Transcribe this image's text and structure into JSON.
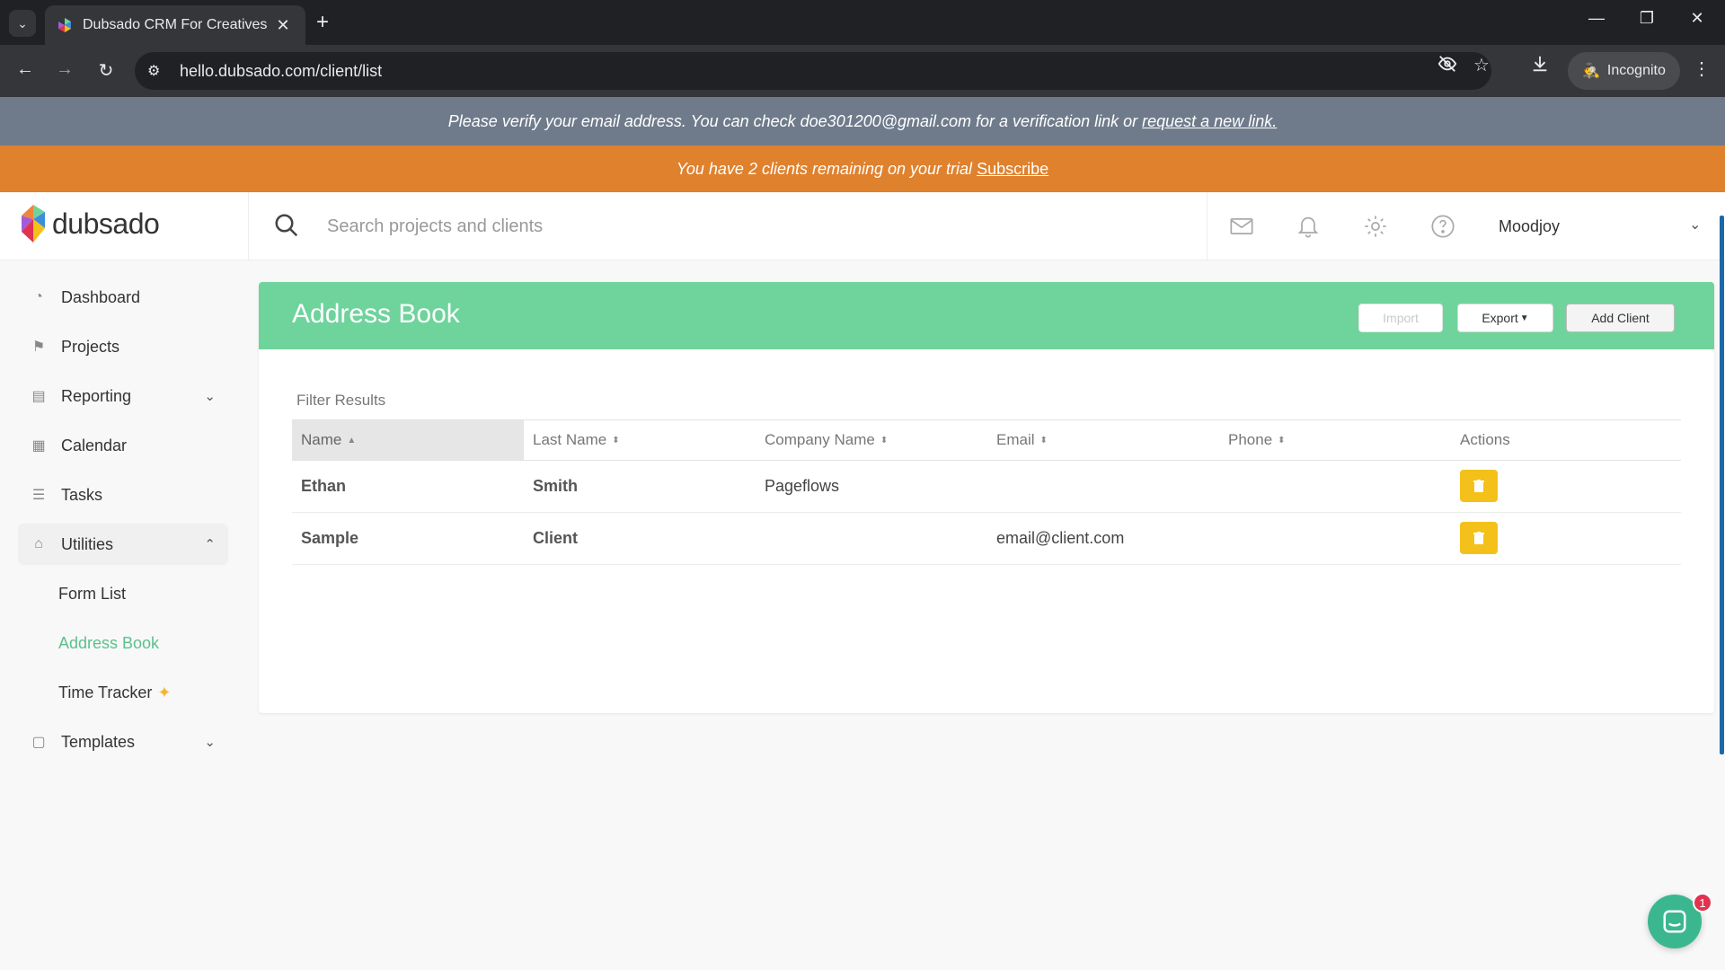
{
  "browser": {
    "tab_title": "Dubsado CRM For Creatives",
    "url": "hello.dubsado.com/client/list",
    "incognito_label": "Incognito"
  },
  "banners": {
    "verify_text": "Please verify your email address. You can check doe301200@gmail.com for a verification link or",
    "verify_link": "request a new link.",
    "trial_text": "You have 2 clients remaining on your trial",
    "trial_link": "Subscribe"
  },
  "header": {
    "logo_text": "dubsado",
    "search_placeholder": "Search projects and clients",
    "user_name": "Moodjoy"
  },
  "sidebar": {
    "items": [
      {
        "label": "Dashboard",
        "icon": "dashboard-icon"
      },
      {
        "label": "Projects",
        "icon": "projects-icon"
      },
      {
        "label": "Reporting",
        "icon": "reporting-icon"
      },
      {
        "label": "Calendar",
        "icon": "calendar-icon"
      },
      {
        "label": "Tasks",
        "icon": "tasks-icon"
      },
      {
        "label": "Utilities",
        "icon": "utilities-icon"
      },
      {
        "label": "Templates",
        "icon": "templates-icon"
      }
    ],
    "sub_items": [
      {
        "label": "Form List"
      },
      {
        "label": "Address Book"
      },
      {
        "label": "Time Tracker"
      }
    ]
  },
  "main": {
    "title": "Address Book",
    "buttons": {
      "import": "Import",
      "export": "Export",
      "add_client": "Add Client"
    },
    "filter_label": "Filter Results",
    "columns": [
      "Name",
      "Last Name",
      "Company Name",
      "Email",
      "Phone",
      "Actions"
    ],
    "rows": [
      {
        "name": "Ethan",
        "last_name": "Smith",
        "company": "Pageflows",
        "email": "",
        "phone": ""
      },
      {
        "name": "Sample",
        "last_name": "Client",
        "company": "",
        "email": "email@client.com",
        "phone": ""
      }
    ]
  },
  "chat": {
    "badge_count": "1"
  },
  "colors": {
    "header_green": "#6fd39c",
    "trial_orange": "#e0812d",
    "verify_slate": "#6f7b8b",
    "delete_yellow": "#f4c11b",
    "active_link_green": "#5cc08c"
  }
}
